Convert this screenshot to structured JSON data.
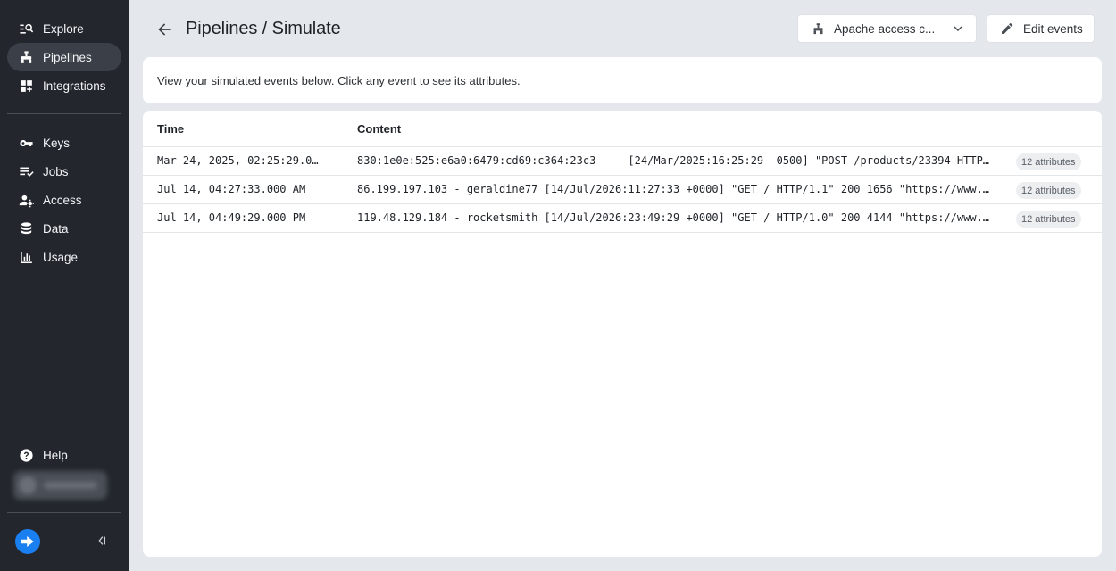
{
  "sidebar": {
    "nav_top": [
      {
        "label": "Explore",
        "icon": "explore-icon"
      },
      {
        "label": "Pipelines",
        "icon": "pipelines-icon",
        "active": true
      },
      {
        "label": "Integrations",
        "icon": "integrations-icon"
      }
    ],
    "nav_bottom": [
      {
        "label": "Keys",
        "icon": "key-icon"
      },
      {
        "label": "Jobs",
        "icon": "jobs-icon"
      },
      {
        "label": "Access",
        "icon": "access-icon"
      },
      {
        "label": "Data",
        "icon": "database-icon"
      },
      {
        "label": "Usage",
        "icon": "usage-chart-icon"
      }
    ],
    "help_label": "Help",
    "accent_color": "#1a7ff0"
  },
  "header": {
    "title": "Pipelines / Simulate",
    "source_select_value": "Apache access c...",
    "edit_events_label": "Edit events"
  },
  "info": {
    "message": "View your simulated events below. Click any event to see its attributes."
  },
  "table": {
    "columns": [
      "Time",
      "Content"
    ],
    "rows": [
      {
        "time": "Mar 24, 2025, 02:25:29.0…",
        "content": "830:1e0e:525:e6a0:6479:cd69:c364:23c3 - - [24/Mar/2025:16:25:29 -0500] \"POST /products/23394 HTTP…",
        "attributes": "12 attributes"
      },
      {
        "time": "Jul 14, 04:27:33.000 AM",
        "content": "86.199.197.103 - geraldine77 [14/Jul/2026:11:27:33 +0000] \"GET / HTTP/1.1\" 200 1656 \"https://www.…",
        "attributes": "12 attributes"
      },
      {
        "time": "Jul 14, 04:49:29.000 PM",
        "content": "119.48.129.184 - rocketsmith [14/Jul/2026:23:49:29 +0000] \"GET / HTTP/1.0\" 200 4144 \"https://www.…",
        "attributes": "12 attributes"
      }
    ]
  }
}
